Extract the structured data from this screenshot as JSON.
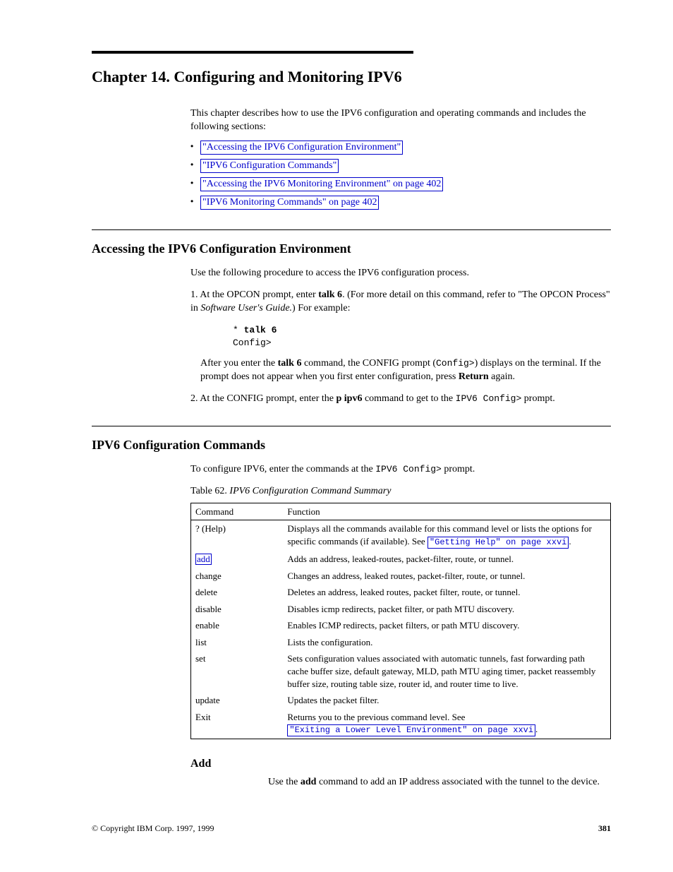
{
  "chapter": {
    "title": "Chapter 14. Configuring and Monitoring IPV6"
  },
  "intro": {
    "lead": "This chapter describes how to use the IPV6 configuration and operating commands and includes the following sections:",
    "bullets": [
      "\"Accessing the IPV6 Configuration Environment\"",
      "\"IPV6 Configuration Commands\"",
      "\"Accessing the IPV6 Monitoring Environment\" on page 402",
      "\"IPV6 Monitoring Commands\" on page 402"
    ]
  },
  "sec1": {
    "heading": "Accessing the IPV6 Configuration Environment",
    "p1": "Use the following procedure to access the IPV6 configuration process.",
    "p2_a": "1. At the OPCON prompt, enter ",
    "p2_b": "talk 6",
    "p2_c": ". (For more detail on this command, refer to \"The OPCON Process\" in ",
    "p2_d": "Software User's Guide.",
    "p2_e": ") For example:",
    "code_star": "* ",
    "code_cmd": "talk 6",
    "code_line2": "Config>",
    "p3_a": "After you enter the ",
    "p3_b": "talk 6",
    "p3_c": " command, the CONFIG prompt (",
    "p3_d": "Config>",
    "p3_e": ") displays on the terminal. If the prompt does not appear when you first enter configuration, press ",
    "p3_f": "Return",
    "p3_g": " again.",
    "p4_a": "2. At the CONFIG prompt, enter the ",
    "p4_b": "p ipv6",
    "p4_c": " command to get to the ",
    "p4_d": "IPV6 Config>",
    "p4_e": " prompt."
  },
  "sec2": {
    "heading": "IPV6 Configuration Commands",
    "p1_a": "To configure IPV6, enter the commands at the ",
    "p1_b": "IPV6 Config>",
    "p1_c": " prompt."
  },
  "table": {
    "caption_num": "Table 62.",
    "caption_text": " IPV6 Configuration Command Summary",
    "headers": [
      "Command",
      "Function"
    ],
    "rows": [
      {
        "cmd": "? (Help)",
        "func_a": "Displays all the commands available for this command level or lists the options for specific commands (if available). See ",
        "func_link": "\"Getting Help\" on page xxvi",
        "func_b": "."
      },
      {
        "cmd": "add",
        "func": "Adds an address, leaked-routes, packet-filter, route, or tunnel."
      },
      {
        "cmd": "change",
        "func": "Changes an address, leaked routes, packet-filter, route, or tunnel."
      },
      {
        "cmd": "delete",
        "func": "Deletes an address, leaked routes, packet filter, route, or tunnel."
      },
      {
        "cmd": "disable",
        "func": "Disables icmp redirects, packet filter, or path MTU discovery."
      },
      {
        "cmd": "enable",
        "func": "Enables ICMP redirects, packet filters, or path MTU discovery."
      },
      {
        "cmd": "list",
        "func": "Lists the configuration."
      },
      {
        "cmd": "set",
        "func": "Sets configuration values associated with automatic tunnels, fast forwarding path cache buffer size, default gateway, MLD, path MTU aging timer, packet reassembly buffer size, routing table size, router id, and router time to live."
      },
      {
        "cmd": "update",
        "func": "Updates the packet filter."
      },
      {
        "cmd": "Exit",
        "func_a": "Returns you to the previous command level. See ",
        "func_link": "\"Exiting a Lower Level Environment\" on page xxvi",
        "func_b": "."
      }
    ]
  },
  "addsec": {
    "heading": "Add",
    "p1_a": "Use the ",
    "p1_b": "add",
    "p1_c": " command to add an IP address associated with the tunnel to the device."
  },
  "footer": {
    "copyright": "© Copyright IBM Corp. 1997, 1999",
    "pagenum": "381"
  }
}
